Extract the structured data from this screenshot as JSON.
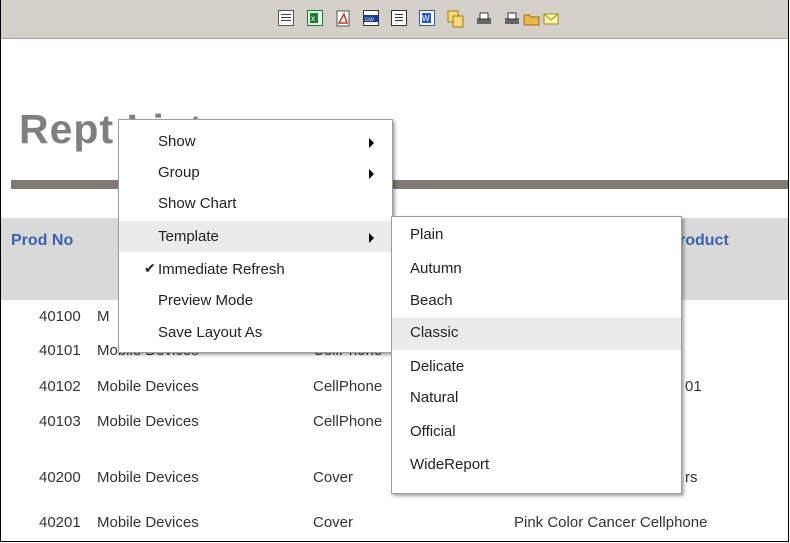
{
  "toolbar": {
    "icons": [
      "list-icon",
      "excel-icon",
      "pdf-icon",
      "csv-icon",
      "text-icon",
      "word-icon",
      "copy-icon",
      "print-icon",
      "print-preview-icon",
      "folder-icon",
      "email-icon"
    ],
    "colors": {
      "excel": "#1e7b34",
      "pdf": "#c0392b",
      "word": "#2a56c6",
      "folder": "#e8b84a"
    }
  },
  "report": {
    "title_visible": "Rep",
    "title_tail": "t List"
  },
  "table": {
    "headers": {
      "prod_no": "Prod No",
      "product": "roduct"
    },
    "rows": [
      {
        "no": "40100",
        "category": "M",
        "type": "",
        "desc": ""
      },
      {
        "no": "40101",
        "category": "Mobile Devices",
        "type": "CellPhone",
        "desc": ""
      },
      {
        "no": "40102",
        "category": "Mobile Devices",
        "type": "CellPhone",
        "desc": "01"
      },
      {
        "no": "40103",
        "category": "Mobile Devices",
        "type": "CellPhone",
        "desc": ""
      },
      {
        "no": "40200",
        "category": "Mobile Devices",
        "type": "Cover",
        "desc": "rs"
      },
      {
        "no": "40201",
        "category": "Mobile Devices",
        "type": "Cover",
        "desc": "Pink Color Cancer Cellphone"
      }
    ]
  },
  "context_menu": {
    "items": [
      {
        "label": "Show"
      },
      {
        "label": "Group"
      },
      {
        "label": "Show Chart"
      },
      {
        "label": "Template"
      },
      {
        "label": "Immediate Refresh",
        "check": "✔"
      },
      {
        "label": "Preview Mode"
      },
      {
        "label": "Save Layout As"
      }
    ]
  },
  "template_submenu": {
    "items": [
      {
        "label": "Plain"
      },
      {
        "label": "Autumn"
      },
      {
        "label": "Beach"
      },
      {
        "label": "Classic"
      },
      {
        "label": "Delicate"
      },
      {
        "label": "Natural"
      },
      {
        "label": "Official"
      },
      {
        "label": "WideReport"
      }
    ],
    "highlighted": "Classic"
  }
}
